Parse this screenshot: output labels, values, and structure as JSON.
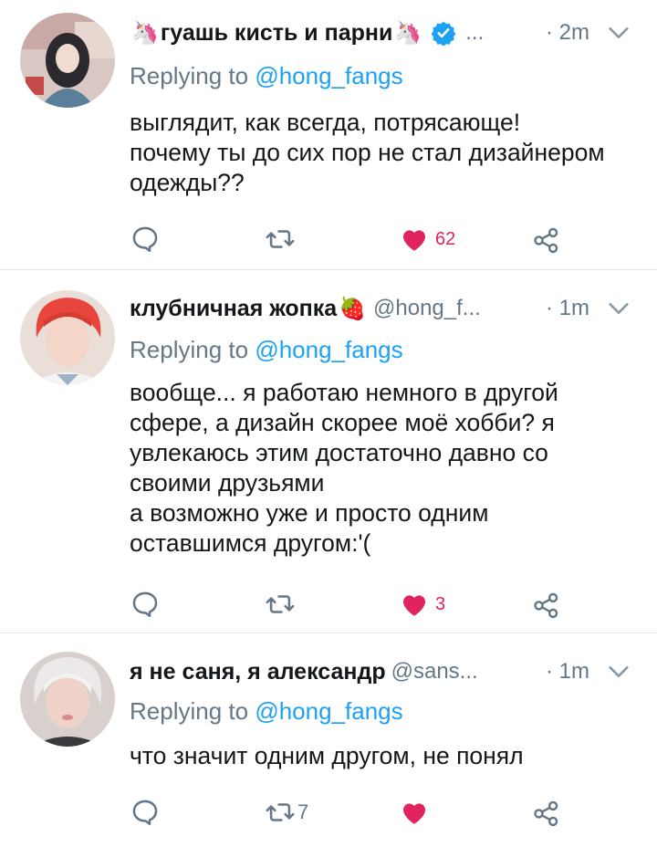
{
  "tweets": [
    {
      "display_name": "гуашь кисть и парни",
      "name_emoji_left": "🦄",
      "name_emoji_right": "🦄",
      "verified": true,
      "handle": "",
      "truncation": "...",
      "time": "· 2m",
      "replying_prefix": "Replying to",
      "replying_to": "@hong_fangs",
      "text": "выглядит, как всегда, потрясающе!\nпочему ты до сих пор не стал дизайнером одежды??",
      "likes": "62",
      "retweets": ""
    },
    {
      "display_name": "клубничная жопка",
      "name_emoji_right": "🍓",
      "verified": false,
      "handle": "@hong_f...",
      "time": "· 1m",
      "replying_prefix": "Replying to",
      "replying_to": "@hong_fangs",
      "text": "вообще... я работаю немного в другой сфере, а дизайн скорее моё хобби? я увлекаюсь этим достаточно давно со своими друзьями\nа возможно уже и просто одним оставшимся другом:'(",
      "likes": "3",
      "retweets": ""
    },
    {
      "display_name": "я не саня, я александр",
      "verified": false,
      "handle": "@sans...",
      "time": "· 1m",
      "replying_prefix": "Replying to",
      "replying_to": "@hong_fangs",
      "text": "что значит одним другом, не понял",
      "likes": "",
      "retweets": "7"
    }
  ],
  "colors": {
    "link": "#1da1f2",
    "like_active": "#e0245e",
    "secondary": "#657786",
    "divider": "#e1e8ed"
  },
  "icons": [
    "reply-icon",
    "retweet-icon",
    "like-icon",
    "share-icon",
    "chevron-down-icon",
    "verified-badge-icon"
  ]
}
